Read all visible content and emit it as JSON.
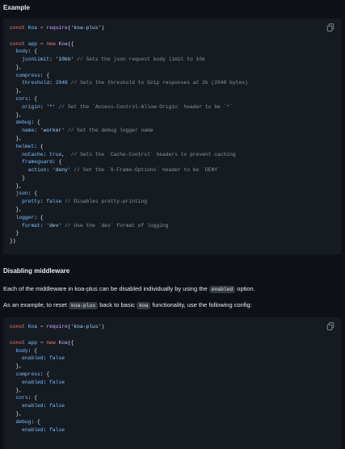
{
  "example_heading": "Example",
  "disabling_heading": "Disabling middleware",
  "para1": {
    "before": "Each of the middleware in koa-plus can be disabled individually by using the",
    "code": "enabled",
    "after": "option."
  },
  "para2": {
    "a": "As an example, to reset",
    "code1": "koa-plus",
    "b": "back to basic",
    "code2": "koa",
    "c": "functionality, use the following config:"
  },
  "icons": {
    "copy": "copy-icon"
  },
  "colors": {
    "background": "#0d1117",
    "code_background": "#161b22",
    "keyword": "#ff7b72",
    "string": "#a5d6ff",
    "property": "#79c0ff",
    "function": "#d2a8ff",
    "comment": "#8b949e"
  },
  "code_example": [
    [
      [
        "k",
        "const"
      ],
      [
        "t",
        " "
      ],
      [
        "p",
        "Koa"
      ],
      [
        "t",
        " "
      ],
      [
        "k",
        "="
      ],
      [
        "t",
        " "
      ],
      [
        "f",
        "require"
      ],
      [
        "t",
        "("
      ],
      [
        "s",
        "'koa-plus'"
      ],
      [
        "t",
        ")"
      ]
    ],
    [],
    [
      [
        "k",
        "const"
      ],
      [
        "t",
        " "
      ],
      [
        "p",
        "app"
      ],
      [
        "t",
        " "
      ],
      [
        "k",
        "="
      ],
      [
        "t",
        " "
      ],
      [
        "k",
        "new"
      ],
      [
        "t",
        " "
      ],
      [
        "f",
        "Koa"
      ],
      [
        "t",
        "({"
      ]
    ],
    [
      [
        "t",
        "  "
      ],
      [
        "p",
        "body"
      ],
      [
        "t",
        ": {"
      ]
    ],
    [
      [
        "t",
        "    "
      ],
      [
        "p",
        "jsonLimit"
      ],
      [
        "t",
        ": "
      ],
      [
        "s",
        "'10kb'"
      ],
      [
        "t",
        " "
      ],
      [
        "c",
        "// Sets the json request body limit to 10k"
      ]
    ],
    [
      [
        "t",
        "  },"
      ]
    ],
    [
      [
        "t",
        "  "
      ],
      [
        "p",
        "compress"
      ],
      [
        "t",
        ": {"
      ]
    ],
    [
      [
        "t",
        "    "
      ],
      [
        "p",
        "threshold"
      ],
      [
        "t",
        ": "
      ],
      [
        "p",
        "2048"
      ],
      [
        "t",
        " "
      ],
      [
        "c",
        "// Sets the threshold to Gzip responses at 2k (2048 bytes)"
      ]
    ],
    [
      [
        "t",
        "  },"
      ]
    ],
    [
      [
        "t",
        "  "
      ],
      [
        "p",
        "cors"
      ],
      [
        "t",
        ": {"
      ]
    ],
    [
      [
        "t",
        "    "
      ],
      [
        "p",
        "origin"
      ],
      [
        "t",
        ": "
      ],
      [
        "s",
        "'*'"
      ],
      [
        "t",
        " "
      ],
      [
        "c",
        "// Set the `Access-Control-Allow-Origin` header to be `*`"
      ]
    ],
    [
      [
        "t",
        "  },"
      ]
    ],
    [
      [
        "t",
        "  "
      ],
      [
        "p",
        "debug"
      ],
      [
        "t",
        ": {"
      ]
    ],
    [
      [
        "t",
        "    "
      ],
      [
        "p",
        "name"
      ],
      [
        "t",
        ": "
      ],
      [
        "s",
        "'worker'"
      ],
      [
        "t",
        " "
      ],
      [
        "c",
        "// Set the debug logger name"
      ]
    ],
    [
      [
        "t",
        "  },"
      ]
    ],
    [
      [
        "t",
        "  "
      ],
      [
        "p",
        "helmet"
      ],
      [
        "t",
        ": {"
      ]
    ],
    [
      [
        "t",
        "    "
      ],
      [
        "p",
        "noCache"
      ],
      [
        "t",
        ": "
      ],
      [
        "p",
        "true"
      ],
      [
        "t",
        ",  "
      ],
      [
        "c",
        "// Sets the `Cache-Control` headers to prevent caching"
      ]
    ],
    [
      [
        "t",
        "    "
      ],
      [
        "p",
        "frameguard"
      ],
      [
        "t",
        ": {"
      ]
    ],
    [
      [
        "t",
        "      "
      ],
      [
        "p",
        "action"
      ],
      [
        "t",
        ": "
      ],
      [
        "s",
        "'deny'"
      ],
      [
        "t",
        " "
      ],
      [
        "c",
        "// Set the `X-Frame-Options` header to be `DENY`"
      ]
    ],
    [
      [
        "t",
        "    }"
      ]
    ],
    [
      [
        "t",
        "  },"
      ]
    ],
    [
      [
        "t",
        "  "
      ],
      [
        "p",
        "json"
      ],
      [
        "t",
        ": {"
      ]
    ],
    [
      [
        "t",
        "    "
      ],
      [
        "p",
        "pretty"
      ],
      [
        "t",
        ": "
      ],
      [
        "p",
        "false"
      ],
      [
        "t",
        " "
      ],
      [
        "c",
        "// Disables pretty-printing"
      ]
    ],
    [
      [
        "t",
        "  },"
      ]
    ],
    [
      [
        "t",
        "  "
      ],
      [
        "p",
        "logger"
      ],
      [
        "t",
        ": {"
      ]
    ],
    [
      [
        "t",
        "    "
      ],
      [
        "p",
        "format"
      ],
      [
        "t",
        ": "
      ],
      [
        "s",
        "'dev'"
      ],
      [
        "t",
        " "
      ],
      [
        "c",
        "// Use the `dev` format of logging"
      ]
    ],
    [
      [
        "t",
        "  }"
      ]
    ],
    [
      [
        "t",
        "})"
      ]
    ]
  ],
  "code_disable": [
    [
      [
        "k",
        "const"
      ],
      [
        "t",
        " "
      ],
      [
        "p",
        "Koa"
      ],
      [
        "t",
        " "
      ],
      [
        "k",
        "="
      ],
      [
        "t",
        " "
      ],
      [
        "f",
        "require"
      ],
      [
        "t",
        "("
      ],
      [
        "s",
        "'koa-plus'"
      ],
      [
        "t",
        ")"
      ]
    ],
    [],
    [
      [
        "k",
        "const"
      ],
      [
        "t",
        " "
      ],
      [
        "p",
        "app"
      ],
      [
        "t",
        " "
      ],
      [
        "k",
        "="
      ],
      [
        "t",
        " "
      ],
      [
        "k",
        "new"
      ],
      [
        "t",
        " "
      ],
      [
        "f",
        "Koa"
      ],
      [
        "t",
        "({"
      ]
    ],
    [
      [
        "t",
        "  "
      ],
      [
        "p",
        "body"
      ],
      [
        "t",
        ": {"
      ]
    ],
    [
      [
        "t",
        "    "
      ],
      [
        "p",
        "enabled"
      ],
      [
        "t",
        ": "
      ],
      [
        "p",
        "false"
      ]
    ],
    [
      [
        "t",
        "  },"
      ]
    ],
    [
      [
        "t",
        "  "
      ],
      [
        "p",
        "compress"
      ],
      [
        "t",
        ": {"
      ]
    ],
    [
      [
        "t",
        "    "
      ],
      [
        "p",
        "enabled"
      ],
      [
        "t",
        ": "
      ],
      [
        "p",
        "false"
      ]
    ],
    [
      [
        "t",
        "  },"
      ]
    ],
    [
      [
        "t",
        "  "
      ],
      [
        "p",
        "cors"
      ],
      [
        "t",
        ": {"
      ]
    ],
    [
      [
        "t",
        "    "
      ],
      [
        "p",
        "enabled"
      ],
      [
        "t",
        ": "
      ],
      [
        "p",
        "false"
      ]
    ],
    [
      [
        "t",
        "  },"
      ]
    ],
    [
      [
        "t",
        "  "
      ],
      [
        "p",
        "debug"
      ],
      [
        "t",
        ": {"
      ]
    ],
    [
      [
        "t",
        "    "
      ],
      [
        "p",
        "enabled"
      ],
      [
        "t",
        ": "
      ],
      [
        "p",
        "false"
      ]
    ]
  ]
}
